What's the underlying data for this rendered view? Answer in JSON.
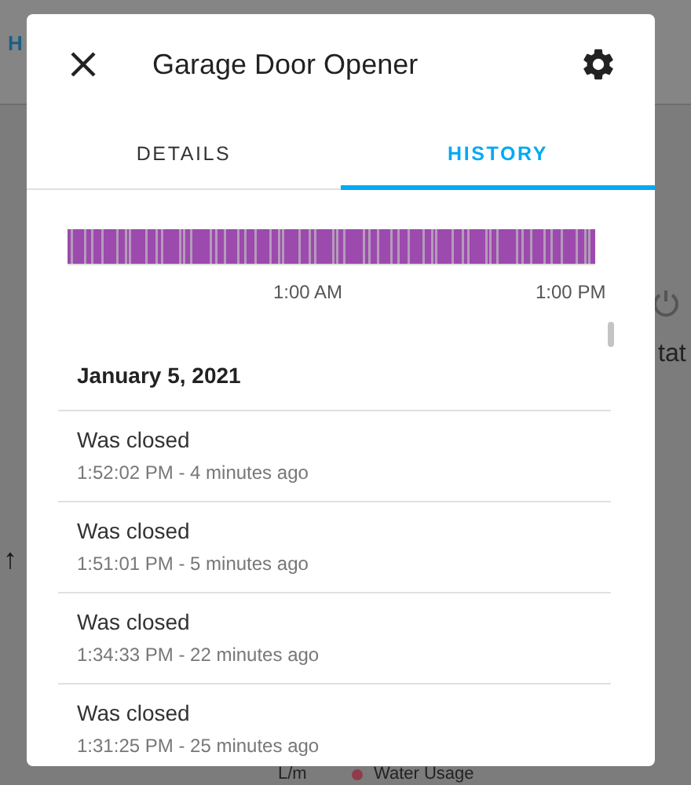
{
  "background": {
    "tab_letter": "H",
    "arrow": "↑",
    "state_text": "tat",
    "unit": "L/m",
    "legend": {
      "label": "Water Usage",
      "color": "#8e3b4a"
    }
  },
  "dialog": {
    "title": "Garage Door Opener"
  },
  "tabs": [
    {
      "label": "DETAILS",
      "selected": false
    },
    {
      "label": "HISTORY",
      "selected": true
    }
  ],
  "timeline": {
    "labels": [
      "1:00 AM",
      "1:00 PM"
    ]
  },
  "history": {
    "date": "January 5, 2021",
    "entries": [
      {
        "message": "Was closed",
        "time": "1:52:02 PM - 4 minutes ago"
      },
      {
        "message": "Was closed",
        "time": "1:51:01 PM - 5 minutes ago"
      },
      {
        "message": "Was closed",
        "time": "1:34:33 PM - 22 minutes ago"
      },
      {
        "message": "Was closed",
        "time": "1:31:25 PM - 25 minutes ago"
      }
    ]
  }
}
